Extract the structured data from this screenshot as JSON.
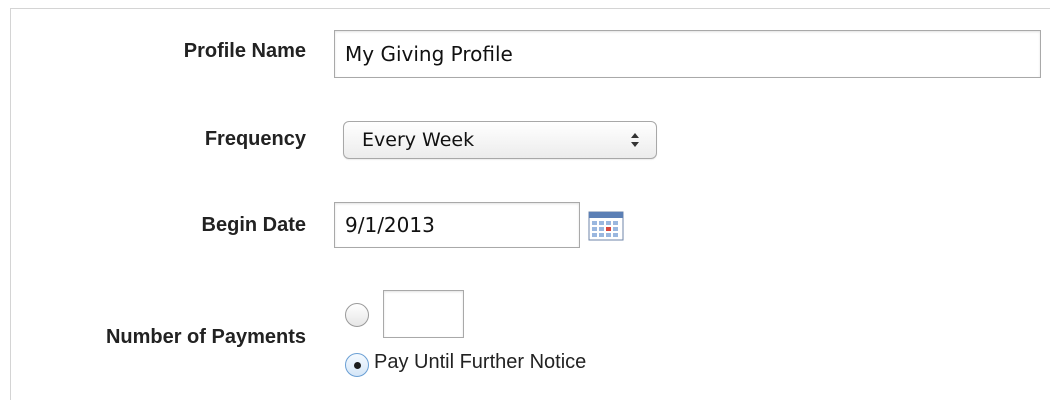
{
  "form": {
    "profile_name": {
      "label": "Profile Name",
      "value": "My Giving Profile"
    },
    "frequency": {
      "label": "Frequency",
      "selected": "Every Week"
    },
    "begin_date": {
      "label": "Begin Date",
      "value": "9/1/2013",
      "picker_icon": "calendar-icon"
    },
    "number_of_payments": {
      "label": "Number of Payments",
      "count_option": {
        "checked": false,
        "value": ""
      },
      "until_notice_option": {
        "checked": true,
        "label": "Pay Until Further Notice"
      }
    }
  }
}
